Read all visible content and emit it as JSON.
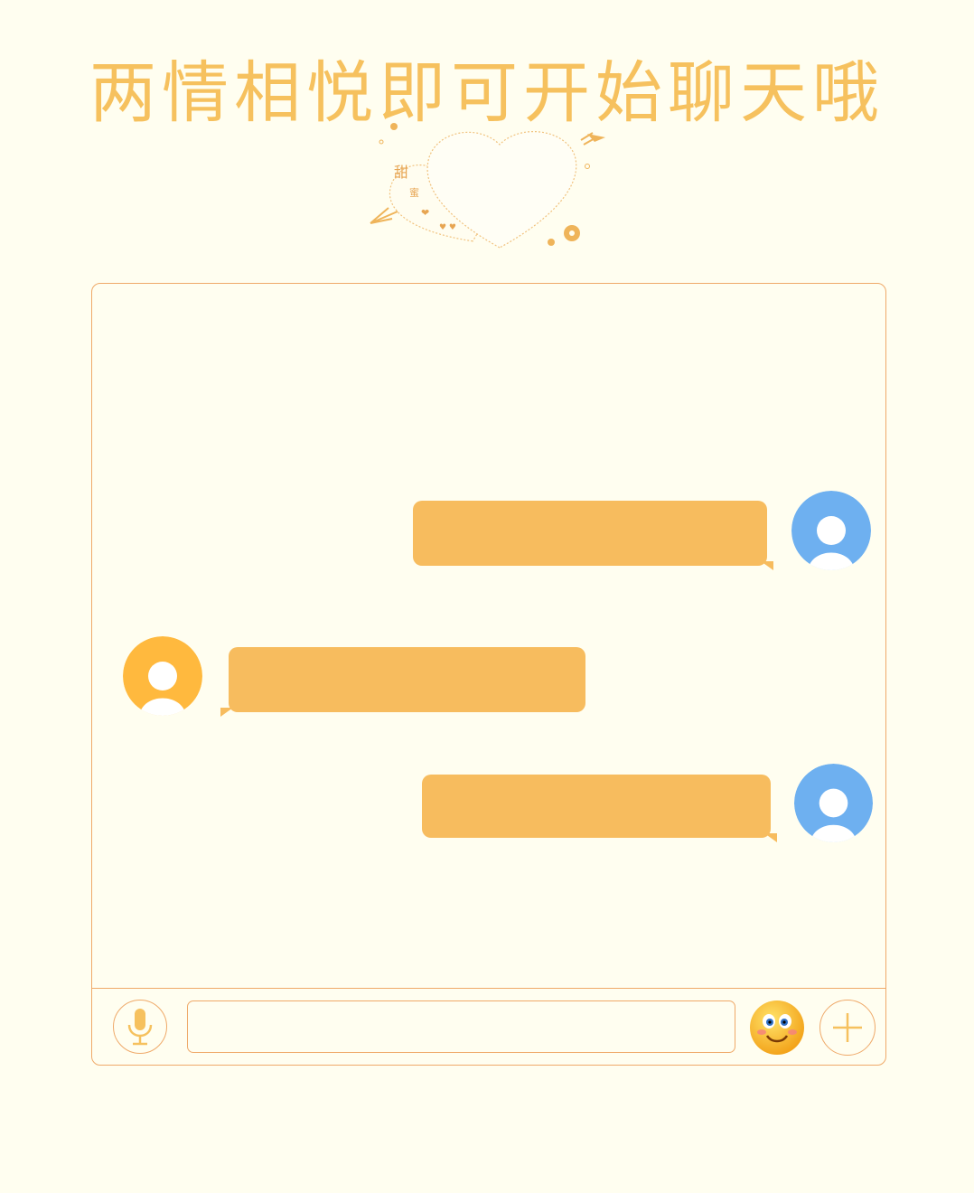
{
  "header": {
    "title": "两情相悦即可开始聊天哦"
  },
  "decoration": {
    "icon": "double-heart-arrow-icon"
  },
  "messages": [
    {
      "side": "right",
      "avatar_color": "#6EB0F0",
      "text": ""
    },
    {
      "side": "left",
      "avatar_color": "#FFB93E",
      "text": ""
    },
    {
      "side": "right",
      "avatar_color": "#6EB0F0",
      "text": ""
    }
  ],
  "input_bar": {
    "voice_icon": "microphone-icon",
    "message_value": "",
    "message_placeholder": "",
    "emoji_icon": "smiley-face-icon",
    "more_icon": "plus-icon"
  },
  "colors": {
    "background": "#FFFEF0",
    "accent": "#F6C15E",
    "border": "#EFA969",
    "bubble": "#F7BC5E",
    "avatar_self": "#6EB0F0",
    "avatar_other": "#FFB93E"
  }
}
